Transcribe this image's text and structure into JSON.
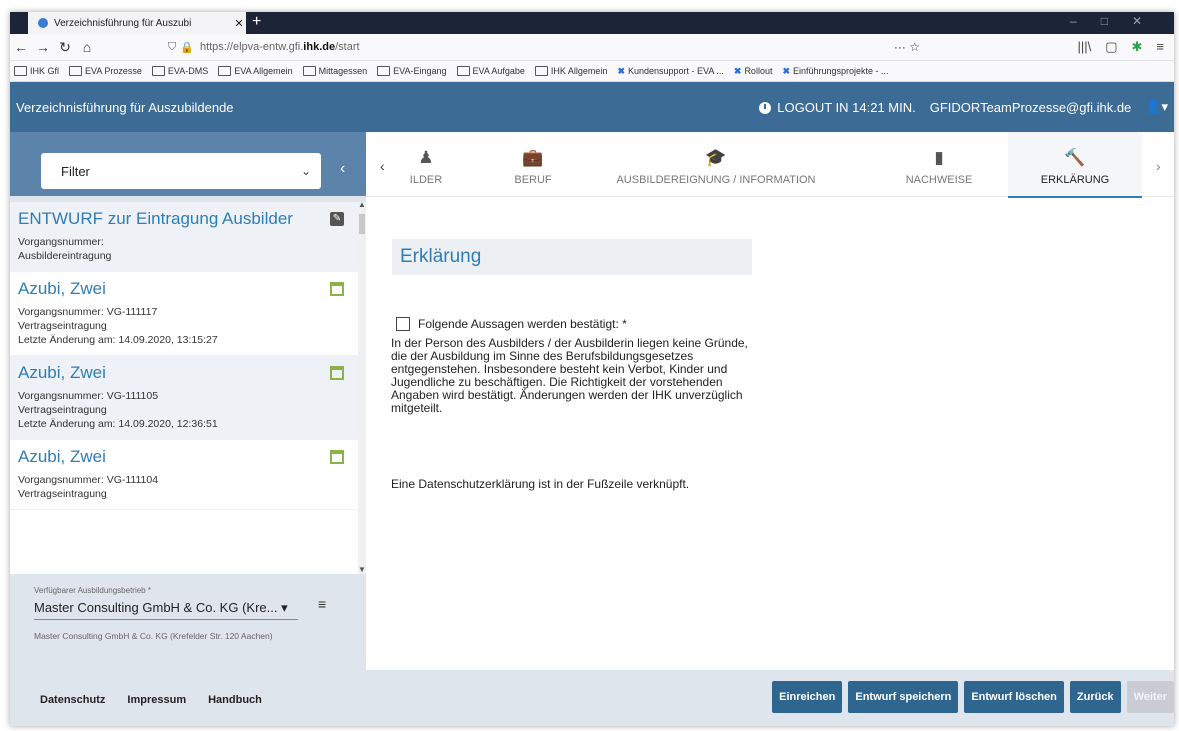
{
  "browser": {
    "tab_title": "Verzeichnisführung für Auszubi",
    "url_prefix": "https://elpva-entw.gfi.",
    "url_domain": "ihk.de",
    "url_path": "/start",
    "bookmarks": [
      "IHK Gfl",
      "EVA Prozesse",
      "EVA-DMS",
      "EVA Allgemein",
      "Mittagessen",
      "EVA-Eingang",
      "EVA Aufgabe",
      "IHK Allgemein",
      "Kundensupport - EVA ...",
      "Rollout",
      "Einführungsprojekte - ..."
    ]
  },
  "header": {
    "title": "Verzeichnisführung für Auszubildende",
    "logout": "LOGOUT IN 14:21 MIN.",
    "user": "GFIDORTeamProzesse@gfi.ihk.de"
  },
  "sidebar": {
    "filter_label": "Filter",
    "items": [
      {
        "title": "ENTWURF zur Eintragung Ausbilder",
        "line1": "Vorgangsnummer:",
        "line2": "Ausbildereintragung",
        "line3": ""
      },
      {
        "title": "Azubi, Zwei",
        "line1": "Vorgangsnummer: VG-111117",
        "line2": "Vertragseintragung",
        "line3": "Letzte Änderung am: 14.09.2020, 13:15:27"
      },
      {
        "title": "Azubi, Zwei",
        "line1": "Vorgangsnummer: VG-111105",
        "line2": "Vertragseintragung",
        "line3": "Letzte Änderung am: 14.09.2020, 12:36:51"
      },
      {
        "title": "Azubi, Zwei",
        "line1": "Vorgangsnummer: VG-111104",
        "line2": "Vertragseintragung",
        "line3": ""
      }
    ],
    "betrieb_label": "Verfügbarer Ausbildungsbetrieb *",
    "betrieb_value": "Master Consulting GmbH & Co. KG (Kre...",
    "betrieb_address": "Master Consulting GmbH & Co. KG (Krefelder Str. 120 Aachen)"
  },
  "tabs": [
    {
      "label": "ILDER",
      "icon": "person-icon"
    },
    {
      "label": "BERUF",
      "icon": "briefcase-icon"
    },
    {
      "label": "AUSBILDEREIGNUNG / INFORMATION",
      "icon": "graduation-cap-icon"
    },
    {
      "label": "NACHWEISE",
      "icon": "document-icon"
    },
    {
      "label": "ERKLÄRUNG",
      "icon": "gavel-icon"
    }
  ],
  "content": {
    "section_title": "Erklärung",
    "checkbox_label": "Folgende Aussagen werden bestätigt: *",
    "paragraph": "In der Person des Ausbilders / der Ausbilderin liegen keine Gründe, die der Ausbildung im Sinne des Berufsbildungsgesetzes entgegenstehen. Insbesondere besteht kein Verbot, Kinder und Jugendliche zu beschäftigen. Die Richtigkeit der vorstehenden Angaben wird bestätigt. Änderungen werden der IHK unverzüglich mitgeteilt.",
    "privacy_note": "Eine Datenschutzerklärung ist in der Fußzeile verknüpft."
  },
  "footer": {
    "links": [
      "Datenschutz",
      "Impressum",
      "Handbuch"
    ],
    "buttons": [
      "Einreichen",
      "Entwurf speichern",
      "Entwurf löschen",
      "Zurück",
      "Weiter"
    ]
  },
  "colors": {
    "header": "#3c6b95",
    "accent": "#2f7db8",
    "button": "#2f6690"
  }
}
